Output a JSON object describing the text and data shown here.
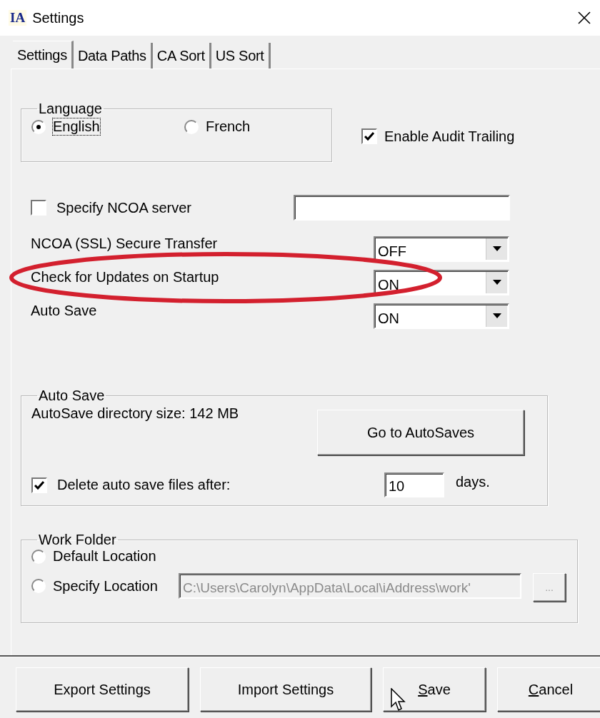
{
  "window": {
    "logo": "IA",
    "title": "Settings"
  },
  "tabs": [
    {
      "label": "Settings",
      "selected": true
    },
    {
      "label": "Data Paths",
      "selected": false
    },
    {
      "label": "CA Sort",
      "selected": false
    },
    {
      "label": "US Sort",
      "selected": false
    }
  ],
  "language": {
    "title": "Language",
    "options": [
      {
        "label": "English",
        "selected": true,
        "focused": true
      },
      {
        "label": "French",
        "selected": false,
        "focused": false
      }
    ]
  },
  "audit": {
    "label": "Enable Audit Trailing",
    "checked": true
  },
  "ncoa_server": {
    "label": "Specify NCOA server",
    "checked": false
  },
  "options": [
    {
      "label": "NCOA (SSL) Secure Transfer",
      "value": "OFF"
    },
    {
      "label": "Check for Updates on Startup",
      "value": "ON"
    },
    {
      "label": "Auto Save",
      "value": "ON"
    }
  ],
  "annotation": {
    "kind": "ellipse",
    "color": "#d3202e"
  },
  "auto_save": {
    "title": "Auto Save",
    "size_text": "AutoSave directory size: 142 MB",
    "button": "Go to AutoSaves",
    "delete_label": "Delete auto save files after:",
    "delete_checked": true,
    "days": "10",
    "days_unit": "days."
  },
  "work_folder": {
    "title": "Work Folder",
    "options": [
      {
        "label": "Default Location",
        "selected": false
      },
      {
        "label": "Specify Location",
        "selected": false
      }
    ],
    "path": "C:\\Users\\Carolyn\\AppData\\Local\\iAddress\\work'",
    "browse": "..."
  },
  "buttons": [
    {
      "label": "Export Settings",
      "underline_first": false
    },
    {
      "label": "Import Settings",
      "underline_first": false
    },
    {
      "label": "Save",
      "underline_first": true
    },
    {
      "label": "Cancel",
      "underline_first": true
    }
  ],
  "cursor": {
    "kind": "arrow"
  }
}
